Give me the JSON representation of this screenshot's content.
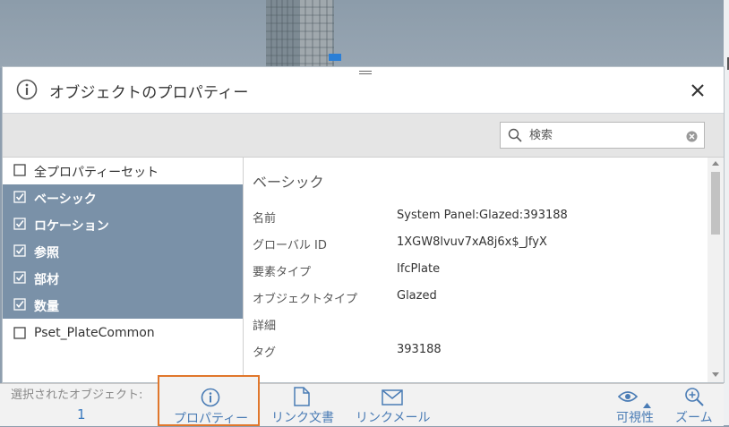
{
  "panel": {
    "title": "オブジェクトのプロパティー",
    "search_placeholder": "検索"
  },
  "property_sets": [
    {
      "label": "全プロパティーセット",
      "checked": false,
      "selected": false
    },
    {
      "label": "ベーシック",
      "checked": true,
      "selected": true
    },
    {
      "label": "ロケーション",
      "checked": true,
      "selected": true
    },
    {
      "label": "参照",
      "checked": true,
      "selected": true
    },
    {
      "label": "部材",
      "checked": true,
      "selected": true
    },
    {
      "label": "数量",
      "checked": true,
      "selected": true
    },
    {
      "label": "Pset_PlateCommon",
      "checked": false,
      "selected": false
    }
  ],
  "details": {
    "section_title": "ベーシック",
    "rows": [
      {
        "key": "名前",
        "value": "System Panel:Glazed:393188"
      },
      {
        "key": "グローバル ID",
        "value": "1XGW8lvuv7xA8j6x$_JfyX"
      },
      {
        "key": "要素タイプ",
        "value": "IfcPlate"
      },
      {
        "key": "オブジェクトタイプ",
        "value": "Glazed"
      },
      {
        "key": "詳細",
        "value": ""
      },
      {
        "key": "タグ",
        "value": "393188"
      }
    ]
  },
  "toolbar": {
    "selected_label": "選択されたオブジェクト:",
    "selected_count": "1",
    "properties_label": "プロパティー",
    "link_document_label": "リンク文書",
    "link_mail_label": "リンクメール",
    "visibility_label": "可視性",
    "zoom_label": "ズーム"
  },
  "colors": {
    "accent": "#4a7cb5",
    "selected_row": "#7a91a8",
    "active_outline": "#e0772c"
  }
}
